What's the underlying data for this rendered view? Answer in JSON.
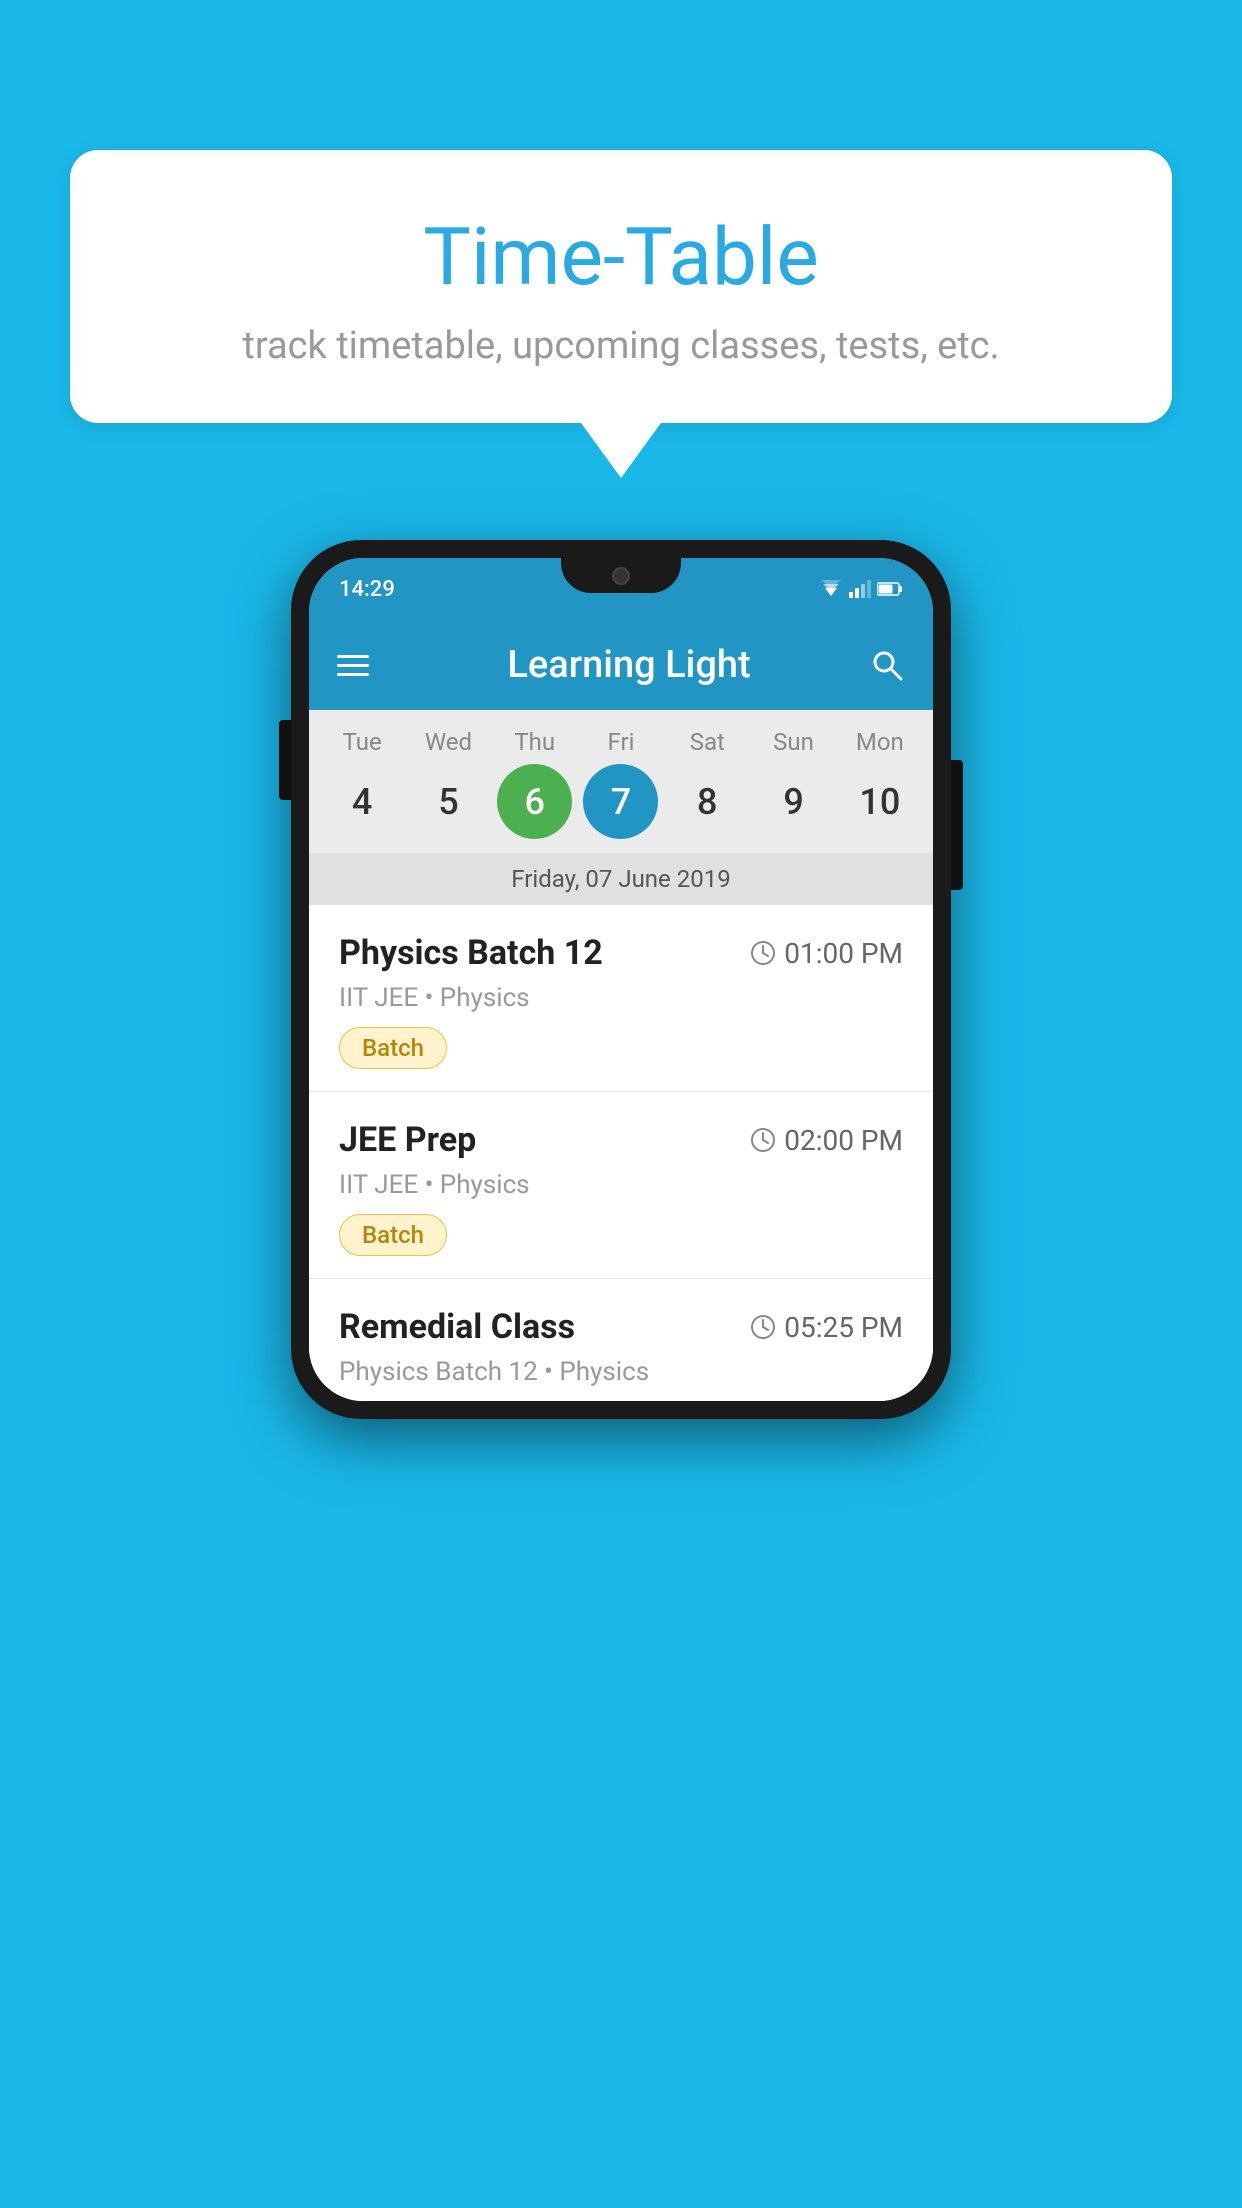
{
  "background_color": "#1ab8e8",
  "speech_bubble": {
    "title": "Time-Table",
    "subtitle": "track timetable, upcoming classes, tests, etc."
  },
  "phone": {
    "status_bar": {
      "time": "14:29"
    },
    "app_bar": {
      "title": "Learning Light"
    },
    "calendar": {
      "days": [
        {
          "label": "Tue",
          "number": "4"
        },
        {
          "label": "Wed",
          "number": "5"
        },
        {
          "label": "Thu",
          "number": "6",
          "state": "today"
        },
        {
          "label": "Fri",
          "number": "7",
          "state": "selected"
        },
        {
          "label": "Sat",
          "number": "8"
        },
        {
          "label": "Sun",
          "number": "9"
        },
        {
          "label": "Mon",
          "number": "10"
        }
      ],
      "selected_date_label": "Friday, 07 June 2019"
    },
    "schedule": [
      {
        "title": "Physics Batch 12",
        "time": "01:00 PM",
        "meta": "IIT JEE • Physics",
        "tag": "Batch"
      },
      {
        "title": "JEE Prep",
        "time": "02:00 PM",
        "meta": "IIT JEE • Physics",
        "tag": "Batch"
      },
      {
        "title": "Remedial Class",
        "time": "05:25 PM",
        "meta": "Physics Batch 12 • Physics",
        "tag": null
      }
    ]
  }
}
